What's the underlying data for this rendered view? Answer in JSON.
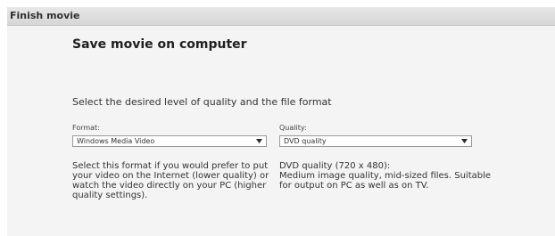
{
  "window": {
    "title": "Finish movie"
  },
  "main": {
    "heading": "Save movie on computer",
    "instruction": "Select the desired level of quality and the file format"
  },
  "format": {
    "label": "Format:",
    "selected": "Windows Media Video",
    "description_lines": [
      "Select this format if you would prefer to put",
      "your video on the Internet (lower quality) or",
      "watch the video directly on your PC (higher",
      "quality settings)."
    ]
  },
  "quality": {
    "label": "Quality:",
    "selected": "DVD quality",
    "description_lines": [
      "DVD quality (720 x 480):",
      "Medium image quality, mid-sized files. Suitable",
      "for output on PC as well as on TV."
    ]
  },
  "icons": {
    "dropdown": "chevron-down-icon"
  },
  "colors": {
    "titlebar": "#dcdcdc",
    "panel": "#f4f4f4",
    "border": "#9a9a9a"
  }
}
